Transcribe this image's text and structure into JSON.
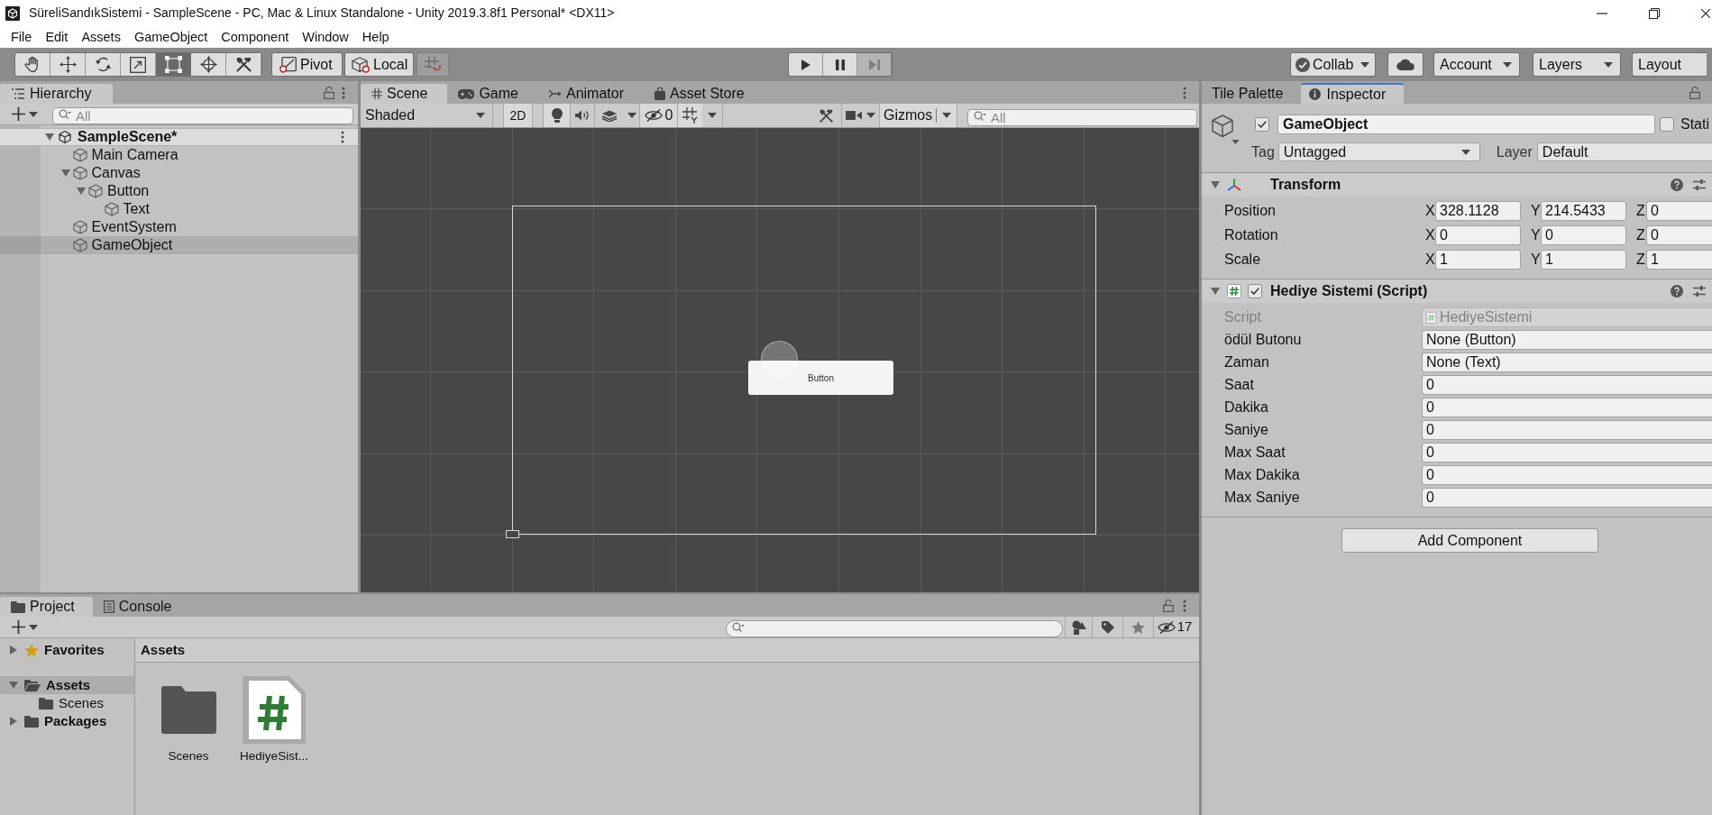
{
  "window": {
    "title": "SüreliSandıkSistemi - SampleScene - PC, Mac & Linux Standalone - Unity 2019.3.8f1 Personal* <DX11>"
  },
  "menu_bar": [
    "File",
    "Edit",
    "Assets",
    "GameObject",
    "Component",
    "Window",
    "Help"
  ],
  "toolbar": {
    "tools": [
      {
        "kind": "hand",
        "selected": false
      },
      {
        "kind": "move",
        "selected": false
      },
      {
        "kind": "rotate",
        "selected": false
      },
      {
        "kind": "scale",
        "selected": false
      },
      {
        "kind": "rect",
        "selected": true
      },
      {
        "kind": "transform",
        "selected": false
      },
      {
        "kind": "custom",
        "selected": false
      }
    ],
    "handle_position": "Pivot",
    "handle_rotation": "Local",
    "snap": {
      "disabled": true
    },
    "playback": [
      {
        "kind": "play",
        "disabled": false
      },
      {
        "kind": "pause",
        "disabled": false
      },
      {
        "kind": "step",
        "disabled": true
      }
    ],
    "collab": "Collab",
    "account": "Account",
    "layers": "Layers",
    "layout": "Layout"
  },
  "hierarchy": {
    "tab": "Hierarchy",
    "search": {
      "placeholder": "All"
    },
    "scene": {
      "name": "SampleScene*",
      "expanded": true
    },
    "items": [
      {
        "name": "Main Camera",
        "selected": false
      },
      {
        "name": "Canvas",
        "selected": false,
        "expanded": true,
        "children": [
          {
            "name": "Button",
            "selected": false,
            "expanded": true,
            "children": [
              {
                "name": "Text",
                "selected": false
              }
            ]
          }
        ]
      },
      {
        "name": "EventSystem",
        "selected": false
      },
      {
        "name": "GameObject",
        "selected": true
      }
    ]
  },
  "scene_panel": {
    "tabs": [
      {
        "kind": "scene",
        "label": "Scene",
        "selected": true
      },
      {
        "kind": "game",
        "label": "Game",
        "selected": false
      },
      {
        "kind": "animator",
        "label": "Animator",
        "selected": false
      },
      {
        "kind": "asset_store",
        "label": "Asset Store",
        "selected": false
      }
    ],
    "toolbar": {
      "draw_mode": "Shaded",
      "mode_2d": "2D",
      "hidden_count": "0",
      "gizmos": "Gizmos",
      "search": {
        "placeholder": "All"
      }
    },
    "view": {
      "ui_button_label": "Button"
    }
  },
  "inspector": {
    "tabs": [
      {
        "kind": "tile_palette",
        "label": "Tile Palette",
        "selected": false,
        "focused": false
      },
      {
        "kind": "inspector",
        "label": "Inspector",
        "selected": true,
        "focused": true
      }
    ],
    "object": {
      "active": true,
      "name": "GameObject",
      "static": false,
      "static_label": "Stati",
      "tag_label": "Tag",
      "tag": "Untagged",
      "layer_label": "Layer",
      "layer": "Default"
    },
    "components": [
      {
        "kind": "transform",
        "title": "Transform",
        "expanded": true,
        "rows": [
          {
            "label": "Position",
            "values": [
              {
                "axis": "X",
                "value": "328.1128"
              },
              {
                "axis": "Y",
                "value": "214.5433"
              },
              {
                "axis": "Z",
                "value": "0"
              }
            ]
          },
          {
            "label": "Rotation",
            "values": [
              {
                "axis": "X",
                "value": "0"
              },
              {
                "axis": "Y",
                "value": "0"
              },
              {
                "axis": "Z",
                "value": "0"
              }
            ]
          },
          {
            "label": "Scale",
            "values": [
              {
                "axis": "X",
                "value": "1"
              },
              {
                "axis": "Y",
                "value": "1"
              },
              {
                "axis": "Z",
                "value": "1"
              }
            ]
          }
        ]
      },
      {
        "kind": "script",
        "title": "Hediye Sistemi (Script)",
        "expanded": true,
        "enabled": true,
        "fields": [
          {
            "kind": "script",
            "label": "Script",
            "value": "HediyeSistemi",
            "disabled": true
          },
          {
            "kind": "object",
            "label": "ödül Butonu",
            "value": "None (Button)",
            "disabled": false
          },
          {
            "kind": "object",
            "label": "Zaman",
            "value": "None (Text)",
            "disabled": false
          },
          {
            "kind": "int",
            "label": "Saat",
            "value": "0",
            "disabled": false
          },
          {
            "kind": "int",
            "label": "Dakika",
            "value": "0",
            "disabled": false
          },
          {
            "kind": "int",
            "label": "Saniye",
            "value": "0",
            "disabled": false
          },
          {
            "kind": "int",
            "label": "Max Saat",
            "value": "0",
            "disabled": false
          },
          {
            "kind": "int",
            "label": "Max Dakika",
            "value": "0",
            "disabled": false
          },
          {
            "kind": "int",
            "label": "Max Saniye",
            "value": "0",
            "disabled": false
          }
        ]
      }
    ],
    "add_component": "Add Component"
  },
  "project": {
    "tabs": [
      {
        "kind": "project",
        "label": "Project",
        "selected": true
      },
      {
        "kind": "console",
        "label": "Console",
        "selected": false
      }
    ],
    "hidden_count": "17",
    "tree": [
      {
        "kind": "favorites",
        "name": "Favorites",
        "expanded": false,
        "selected": false
      },
      {
        "kind": "folder",
        "name": "Assets",
        "expanded": true,
        "selected": true,
        "children": [
          {
            "kind": "folder",
            "name": "Scenes",
            "selected": false
          }
        ]
      },
      {
        "kind": "folder",
        "name": "Packages",
        "expanded": false,
        "selected": false
      }
    ],
    "breadcrumb": "Assets",
    "assets": [
      {
        "kind": "folder",
        "name": "Scenes"
      },
      {
        "kind": "script",
        "name": "HediyeSist..."
      }
    ]
  }
}
